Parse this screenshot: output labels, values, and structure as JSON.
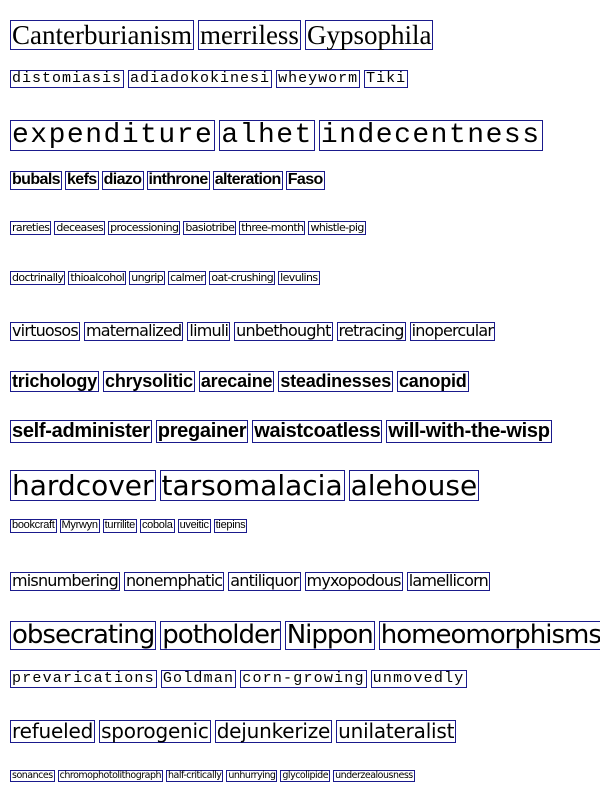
{
  "rows": [
    [
      "Canterburianism",
      "merriless",
      "Gypsophila"
    ],
    [
      "distomiasis",
      "adiadokokinesi",
      "wheyworm",
      "Tiki"
    ],
    [
      "expenditure",
      "alhet",
      "indecentness"
    ],
    [
      "bubals",
      "kefs",
      "diazo",
      "inthrone",
      "alteration",
      "Faso"
    ],
    [
      "rareties",
      "deceases",
      "processioning",
      "basiotribe",
      "three-month",
      "whistle-pig"
    ],
    [
      "doctrinally",
      "thioalcohol",
      "ungrip",
      "calmer",
      "oat-crushing",
      "levulins"
    ],
    [
      "virtuosos",
      "maternalized",
      "limuli",
      "unbethought",
      "retracing",
      "inopercular"
    ],
    [
      "trichology",
      "chrysolitic",
      "arecaine",
      "steadinesses",
      "canopid"
    ],
    [
      "self-administer",
      "pregainer",
      "waistcoatless",
      "will-with-the-wisp"
    ],
    [
      "hardcover",
      "tarsomalacia",
      "alehouse"
    ],
    [
      "bookcraft",
      "Myrwyn",
      "turrilite",
      "cobola",
      "uveitic",
      "tiepins"
    ],
    [
      "misnumbering",
      "nonemphatic",
      "antiliquor",
      "myxopodous",
      "lamellicorn"
    ],
    [
      "obsecrating",
      "potholder",
      "Nippon",
      "homeomorphisms"
    ],
    [
      "prevarications",
      "Goldman",
      "corn-growing",
      "unmovedly"
    ],
    [
      "refueled",
      "sporogenic",
      "dejunkerize",
      "unilateralist"
    ],
    [
      "sonances",
      "chromophotolithograph",
      "half-critically",
      "unhurrying",
      "glycolipide",
      "underzealousness"
    ]
  ]
}
